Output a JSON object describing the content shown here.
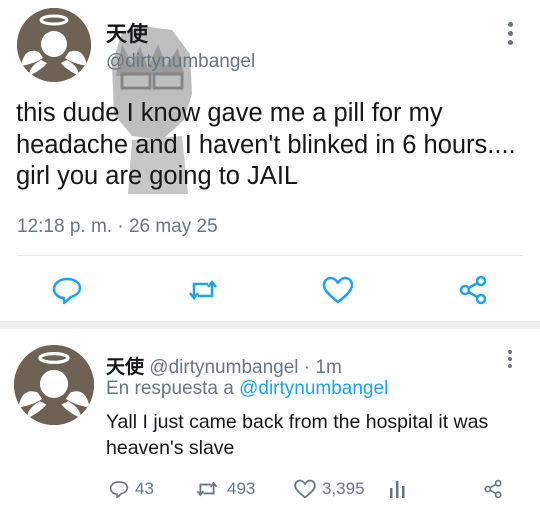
{
  "colors": {
    "accent": "#1da1f2",
    "text": "#14171a",
    "secondary": "#657786",
    "divider": "#e1e8ed",
    "avatar": "#6e6255"
  },
  "main_tweet": {
    "display_name": "天使",
    "handle": "@dirtynumbangel",
    "text": "this dude I know gave me a pill for my headache and I haven't blinked in 6 hours.... girl you are going to JAIL",
    "timestamp": "12:18 p. m. · 26 may 25",
    "actions": {
      "reply_icon": "reply-icon",
      "retweet_icon": "retweet-icon",
      "like_icon": "heart-icon",
      "share_icon": "share-icon"
    }
  },
  "reply_tweet": {
    "display_name": "天使",
    "handle_time": "@dirtynumbangel · 1m",
    "reply_prefix": "En respuesta a",
    "reply_mention": "@dirtynumbangel",
    "text": "Yall I just came back from the hospital it was heaven's slave",
    "counts": {
      "replies": "43",
      "retweets": "493",
      "likes": "3,395"
    }
  }
}
